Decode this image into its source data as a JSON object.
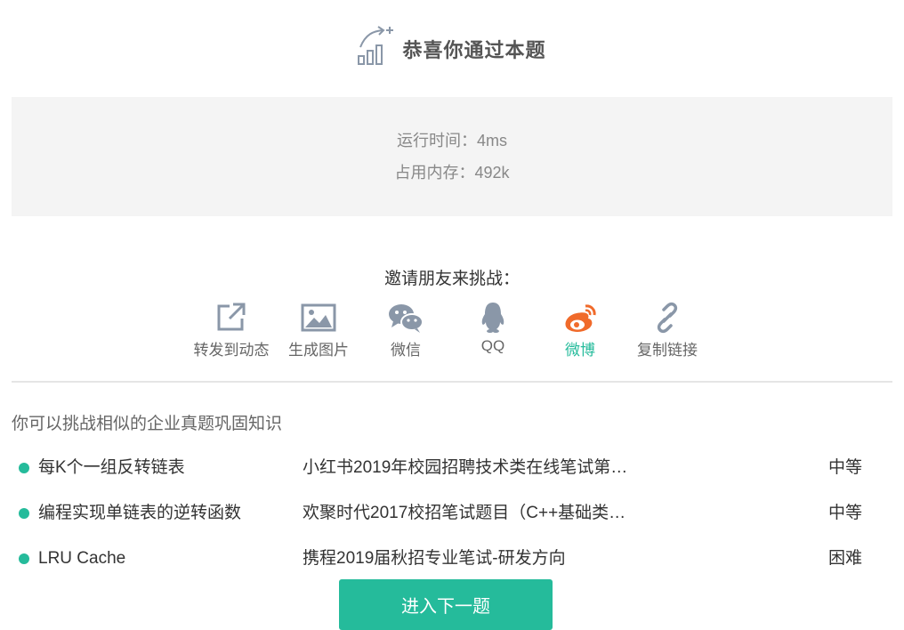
{
  "header": {
    "title": "恭喜你通过本题",
    "icon": "chart-growth-icon"
  },
  "stats": {
    "runtime": "运行时间：4ms",
    "memory": "占用内存：492k"
  },
  "share": {
    "invite_text": "邀请朋友来挑战：",
    "items": [
      {
        "label": "转发到动态",
        "icon": "share-out-icon"
      },
      {
        "label": "生成图片",
        "icon": "image-icon"
      },
      {
        "label": "微信",
        "icon": "wechat-icon"
      },
      {
        "label": "QQ",
        "icon": "qq-icon"
      },
      {
        "label": "微博",
        "icon": "weibo-icon",
        "active": true
      },
      {
        "label": "复制链接",
        "icon": "link-icon"
      }
    ],
    "colors": {
      "icon": "#8a97a8",
      "weibo": "#f06a2a",
      "accent": "#25bb9b"
    }
  },
  "similar": {
    "heading": "你可以挑战相似的企业真题巩固知识",
    "problems": [
      {
        "name": "每K个一组反转链表",
        "source": "小红书2019年校园招聘技术类在线笔试第…",
        "difficulty": "中等"
      },
      {
        "name": "编程实现单链表的逆转函数",
        "source": "欢聚时代2017校招笔试题目（C++基础类…",
        "difficulty": "中等"
      },
      {
        "name": "LRU Cache",
        "source": "携程2019届秋招专业笔试-研发方向",
        "difficulty": "困难"
      }
    ]
  },
  "next_button": {
    "label": "进入下一题"
  }
}
